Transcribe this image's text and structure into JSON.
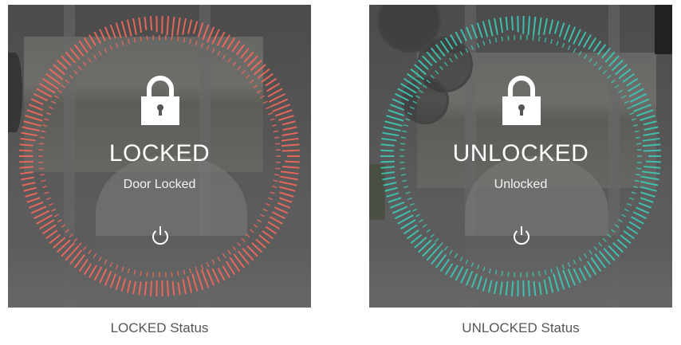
{
  "panels": [
    {
      "status_title": "LOCKED",
      "status_subtitle": "Door Locked",
      "caption": "LOCKED Status",
      "accent_color": "#f26a5c",
      "lock_icon": "padlock-closed-icon",
      "power_icon": "power-icon"
    },
    {
      "status_title": "UNLOCKED",
      "status_subtitle": "Unlocked",
      "caption": "UNLOCKED Status",
      "accent_color": "#3ec9b6",
      "lock_icon": "padlock-closed-icon",
      "power_icon": "power-icon"
    }
  ]
}
